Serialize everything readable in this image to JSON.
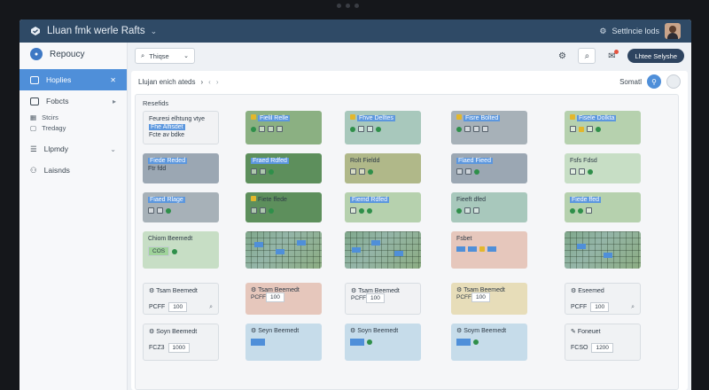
{
  "topbar": {
    "title": "Lluan fmk werle Rafts",
    "right_text": "Settlncie lods"
  },
  "sidebar": {
    "header": "Repoucy",
    "items": [
      {
        "label": "Hoplies"
      },
      {
        "label": "Fobcts"
      },
      {
        "label": "Stcirs"
      },
      {
        "label": "Tredagy"
      },
      {
        "label": "Llpmdy"
      },
      {
        "label": "Laisnds"
      }
    ]
  },
  "toolbar": {
    "search_label": "Thiqse",
    "pill_label": "Lhtee Selyshe"
  },
  "breadcrumb": {
    "text": "Llujan enich ateds",
    "right_label": "Somatl"
  },
  "panel": {
    "title": "Resefids"
  },
  "cards": [
    {
      "l1": "Feuresi elhtung vtye",
      "l2": "Fhe Alfisdet",
      "l3": "Fcte av bdke"
    },
    {
      "l1": "Fielil Relle"
    },
    {
      "l1": "Fhve Delltes"
    },
    {
      "l1": "Fisre Bolted"
    },
    {
      "l1": "Fisele Dolkta"
    },
    {
      "l1": "Fiede Reded",
      "l2": "Ftr fdd"
    },
    {
      "l1": "Fraed Rdfed"
    },
    {
      "l1": "Rolt Fieldd"
    },
    {
      "l1": "Flaed Fieed"
    },
    {
      "l1": "Fsfs Fdsd"
    },
    {
      "l1": "Fiaed Rlage"
    },
    {
      "l1": "Fiete ffede"
    },
    {
      "l1": "Fiemd Rdfed"
    },
    {
      "l1": "Fieeft dfed"
    },
    {
      "l1": "Fiede ffed"
    },
    {
      "l1": "Chiom Beemedt",
      "l2": "COS"
    },
    {
      "l1": "Fsbet"
    },
    {
      "l1": "Tsam Beemedt",
      "l2": "PCFF",
      "l3": "100"
    },
    {
      "l1": "Tsam Beemedt",
      "l2": "PCFF",
      "l3": "100"
    },
    {
      "l1": "Tsam Beemedt",
      "l2": "PCFF",
      "l3": "100"
    },
    {
      "l1": "Tsam Beemedt",
      "l2": "PCFF",
      "l3": "100"
    },
    {
      "l1": "Eseemed",
      "l2": "PCFF",
      "l3": "100"
    },
    {
      "l1": "Soyn Beemedt",
      "l2": "FCZ3",
      "l3": "1000"
    },
    {
      "l1": "Seyn Beemedt"
    },
    {
      "l1": "Soyn Beemedt"
    },
    {
      "l1": "Soym Beemedt"
    },
    {
      "l1": "Foneuet",
      "l2": "FCSO",
      "l3": "1200"
    }
  ],
  "colors": {
    "topbar": "#2f4a66",
    "accent": "#4f8fd9",
    "pill": "#2e4460"
  }
}
